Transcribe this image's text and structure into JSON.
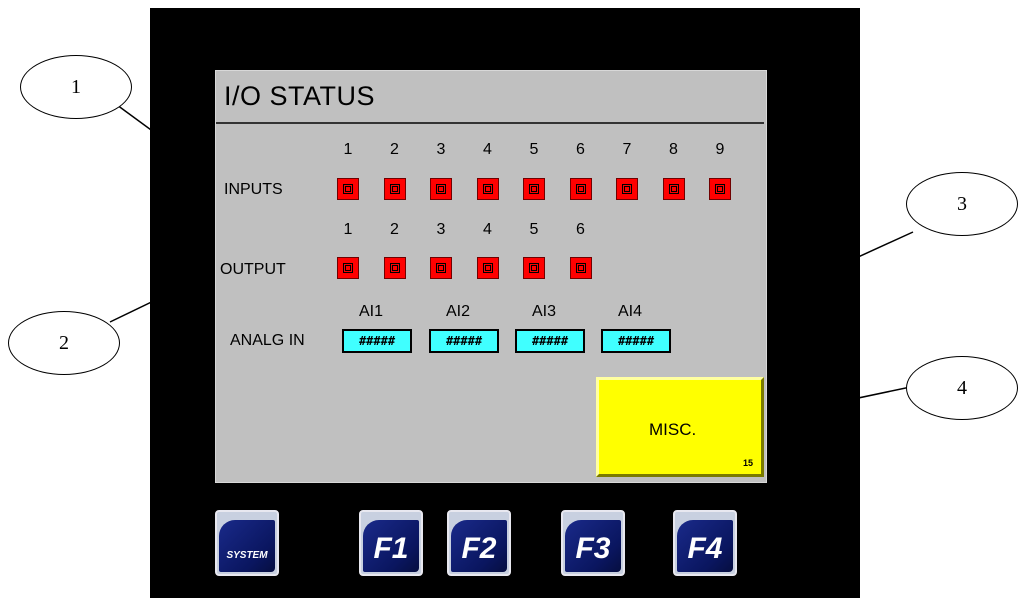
{
  "screen": {
    "title": "I/O STATUS",
    "inputs": {
      "label": "INPUTS",
      "numbers": [
        "1",
        "2",
        "3",
        "4",
        "5",
        "6",
        "7",
        "8",
        "9"
      ],
      "state_color": "#ff0000"
    },
    "outputs": {
      "label": "OUTPUT",
      "numbers": [
        "1",
        "2",
        "3",
        "4",
        "5",
        "6"
      ],
      "state_color": "#ff0000"
    },
    "analog": {
      "label": "ANALG IN",
      "channels": [
        {
          "name": "AI1",
          "value": "#####"
        },
        {
          "name": "AI2",
          "value": "#####"
        },
        {
          "name": "AI3",
          "value": "#####"
        },
        {
          "name": "AI4",
          "value": "#####"
        }
      ],
      "box_color": "#40ffff"
    },
    "misc_button": {
      "label": "MISC.",
      "number": "15",
      "color": "#ffff00"
    }
  },
  "function_keys": [
    {
      "label": "SYSTEM"
    },
    {
      "label": "F1"
    },
    {
      "label": "F2"
    },
    {
      "label": "F3"
    },
    {
      "label": "F4"
    }
  ],
  "callouts": [
    "1",
    "2",
    "3",
    "4"
  ],
  "colors": {
    "bezel": "#000000",
    "screen": "#c0c0c0",
    "key_blue": "#0a1660"
  }
}
